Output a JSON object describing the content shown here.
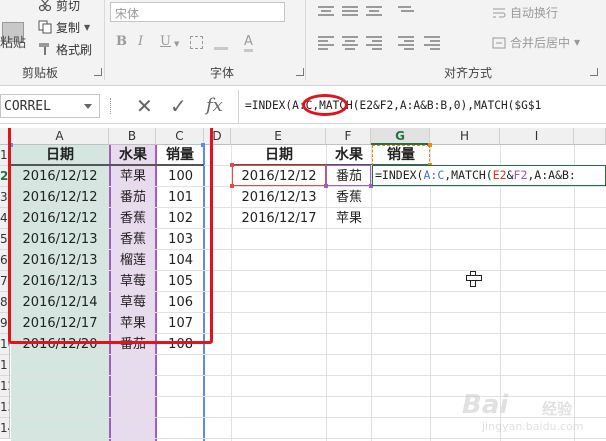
{
  "ribbon": {
    "clipboard": {
      "paste_label": "粘贴",
      "cut_label": "剪切",
      "copy_label": "复制",
      "format_painter_label": "格式刷",
      "group_label": "剪贴板"
    },
    "font": {
      "font_name": "宋体",
      "bold": "B",
      "italic": "I",
      "underline": "U",
      "group_label": "字体"
    },
    "alignment": {
      "wrap_text_label": "自动换行",
      "merge_center_label": "合并后居中",
      "group_label": "对齐方式"
    }
  },
  "formula_bar": {
    "name_box": "CORREL",
    "cancel_glyph": "✕",
    "enter_glyph": "✓",
    "fx_glyph": "fx",
    "formula": "=INDEX(A:C,MATCH(E2&F2,A:A&B:B,0),MATCH($G$1"
  },
  "sheet": {
    "columns": [
      "A",
      "B",
      "C",
      "D",
      "E",
      "F",
      "G",
      "H",
      "I"
    ],
    "active_column": "G",
    "rows": [
      "1",
      "2",
      "3",
      "4",
      "5",
      "6",
      "7",
      "8",
      "9",
      "10",
      "11",
      "12",
      "13",
      "14"
    ],
    "active_row": "2",
    "table_left": {
      "headers": [
        "日期",
        "水果",
        "销量"
      ],
      "rows": [
        [
          "2016/12/12",
          "苹果",
          "100"
        ],
        [
          "2016/12/12",
          "番茄",
          "101"
        ],
        [
          "2016/12/12",
          "香蕉",
          "102"
        ],
        [
          "2016/12/13",
          "香蕉",
          "103"
        ],
        [
          "2016/12/13",
          "榴莲",
          "104"
        ],
        [
          "2016/12/13",
          "草莓",
          "105"
        ],
        [
          "2016/12/14",
          "草莓",
          "106"
        ],
        [
          "2016/12/17",
          "苹果",
          "107"
        ],
        [
          "2016/12/20",
          "番茄",
          "108"
        ]
      ]
    },
    "table_right": {
      "headers": [
        "日期",
        "水果",
        "销量"
      ],
      "rows": [
        [
          "2016/12/12",
          "番茄"
        ],
        [
          "2016/12/13",
          "香蕉"
        ],
        [
          "2016/12/17",
          "苹果"
        ]
      ]
    },
    "edit_cell": {
      "prefix": "=INDEX(",
      "ref_ac": "A:C",
      "mid": ",MATCH(",
      "ref_e2": "E2",
      "amp1": "&",
      "ref_f2": "F2",
      "tail": ",A:A&B:"
    }
  },
  "watermark": {
    "brand": "Bai",
    "brand_cn": "经验",
    "url": "jingyan.baidu.com"
  },
  "colors": {
    "highlight_red": "#e0141e",
    "excel_green": "#217346",
    "ref_blue": "#3b72d6",
    "ref_red": "#d0342b",
    "ref_purple": "#9b52c4"
  }
}
